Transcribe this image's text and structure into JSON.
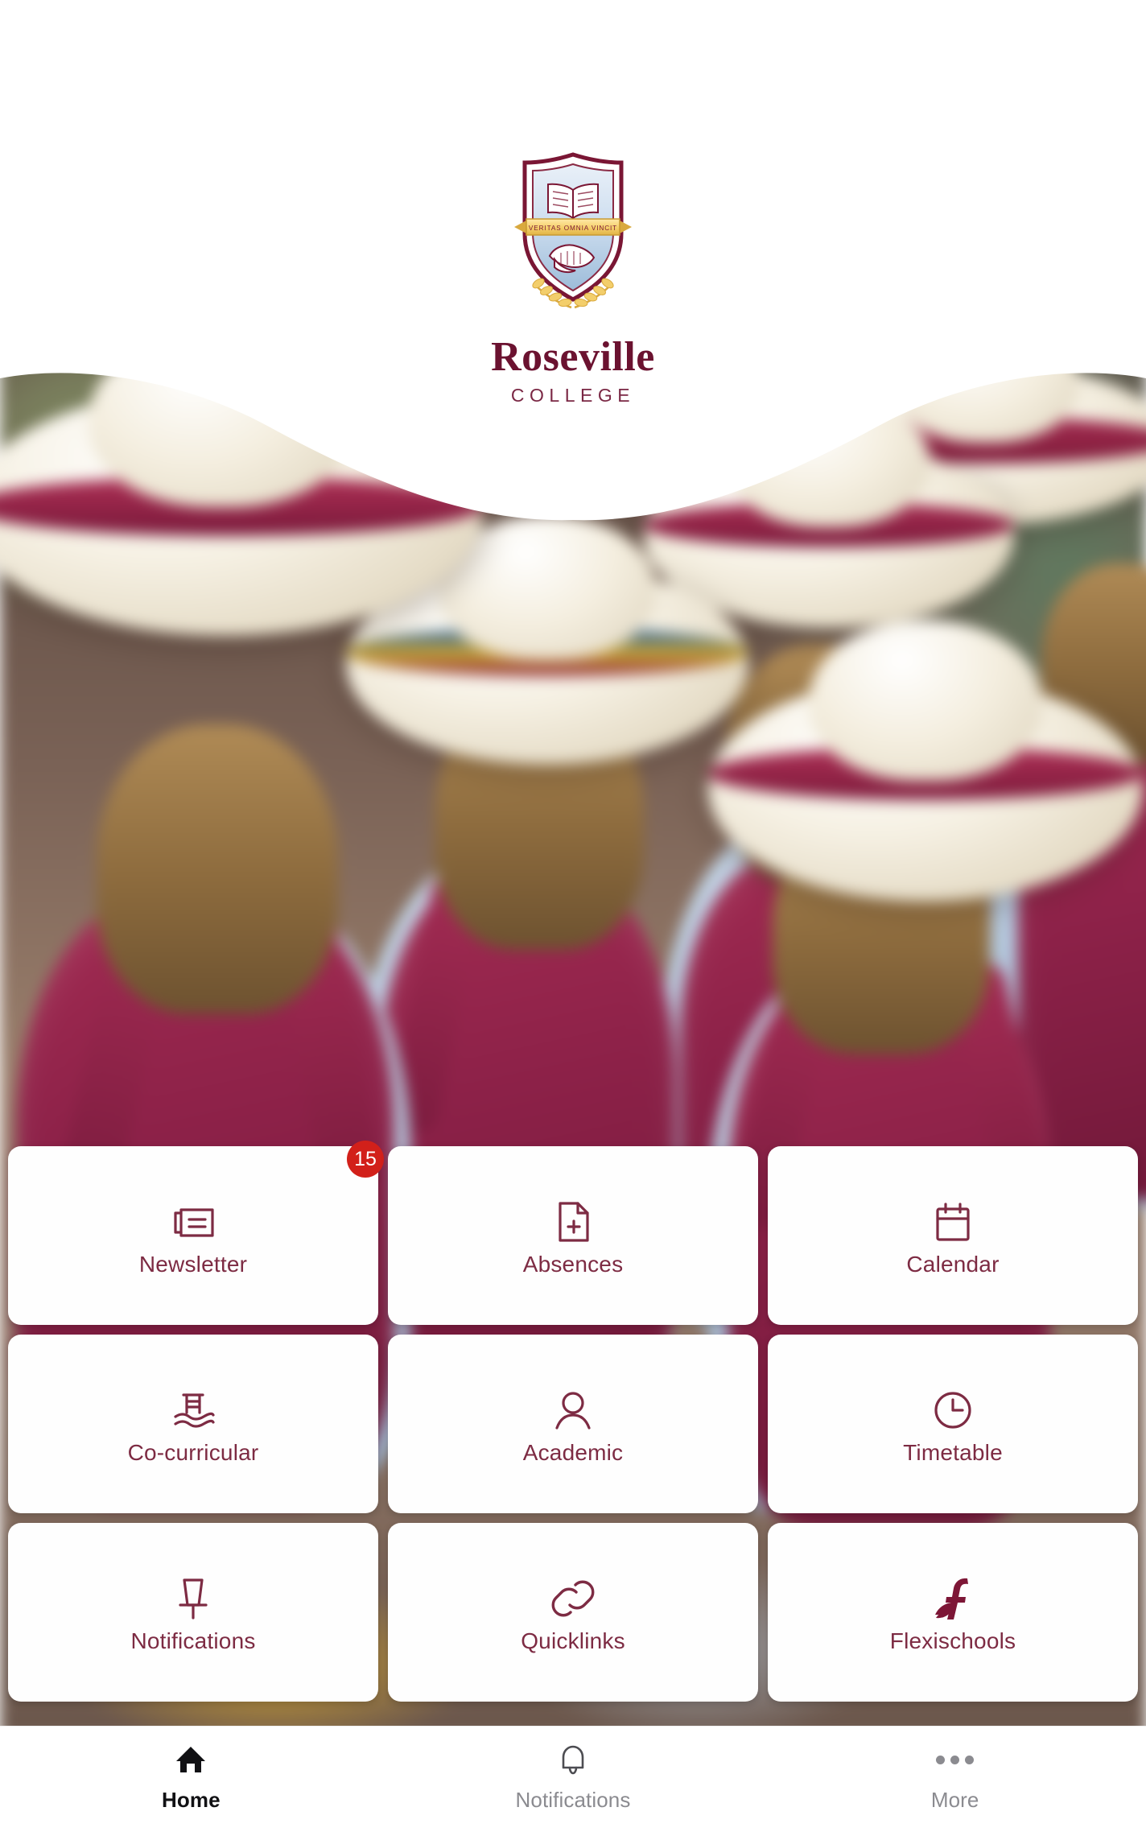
{
  "header": {
    "school_name": "Roseville",
    "school_subtitle": "COLLEGE",
    "crest_motto": "VERITAS OMNIA VINCIT",
    "crest_icon": "school-crest-shield-icon"
  },
  "hero": {
    "alt": "students-in-uniform-hats-with-backpacks-photo"
  },
  "tiles": [
    {
      "label": "Newsletter",
      "icon": "newspaper-icon",
      "badge": "15"
    },
    {
      "label": "Absences",
      "icon": "file-plus-icon",
      "badge": null
    },
    {
      "label": "Calendar",
      "icon": "calendar-icon",
      "badge": null
    },
    {
      "label": "Co-curricular",
      "icon": "pool-ladder-icon",
      "badge": null
    },
    {
      "label": "Academic",
      "icon": "person-icon",
      "badge": null
    },
    {
      "label": "Timetable",
      "icon": "clock-icon",
      "badge": null
    },
    {
      "label": "Notifications",
      "icon": "pushpin-icon",
      "badge": null
    },
    {
      "label": "Quicklinks",
      "icon": "chain-link-icon",
      "badge": null
    },
    {
      "label": "Flexischools",
      "icon": "flexischools-f-logo-icon",
      "badge": null
    }
  ],
  "tabbar": [
    {
      "label": "Home",
      "icon": "home-icon",
      "active": true
    },
    {
      "label": "Notifications",
      "icon": "bell-icon",
      "active": false
    },
    {
      "label": "More",
      "icon": "ellipsis-more-icon",
      "active": false
    }
  ],
  "colors": {
    "brand_maroon": "#6b1230",
    "tile_label": "#7d2b43",
    "badge_red": "#d2201a",
    "tab_active": "#111114",
    "tab_inactive": "#8b8b90",
    "card_background": "#fefefe"
  }
}
